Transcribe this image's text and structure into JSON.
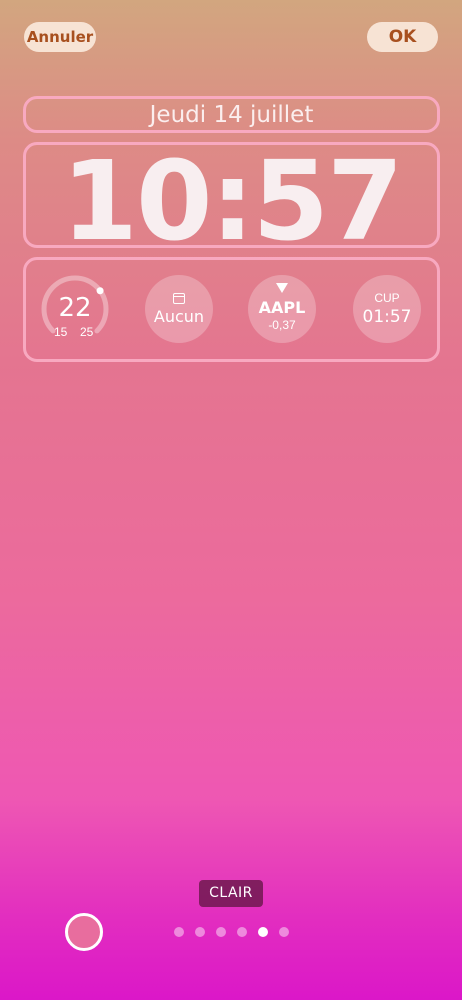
{
  "header": {
    "cancel_label": "Annuler",
    "ok_label": "OK"
  },
  "lockscreen": {
    "date": "Jeudi 14 juillet",
    "time": "10:57"
  },
  "widgets": {
    "weather": {
      "current": "22",
      "low": "15",
      "high": "25",
      "range_fraction": 0.7,
      "icon": "temperature-gauge-icon"
    },
    "calendar": {
      "label": "Aucun",
      "icon": "calendar-icon"
    },
    "stock": {
      "symbol": "AAPL",
      "change": "-0,37",
      "icon": "down-triangle-icon"
    },
    "world_clock": {
      "city": "CUP",
      "time": "01:57"
    }
  },
  "bottom": {
    "filter_label": "CLAIR",
    "swatch_color": "#e86d9e",
    "page_count": 6,
    "active_page": 5
  },
  "colors": {
    "button_bg": "#f7e3d4",
    "button_text": "#a8501f",
    "box_border": "#f8a9c0",
    "gradient_top": "#d2a67f",
    "gradient_bottom": "#db17c8"
  }
}
